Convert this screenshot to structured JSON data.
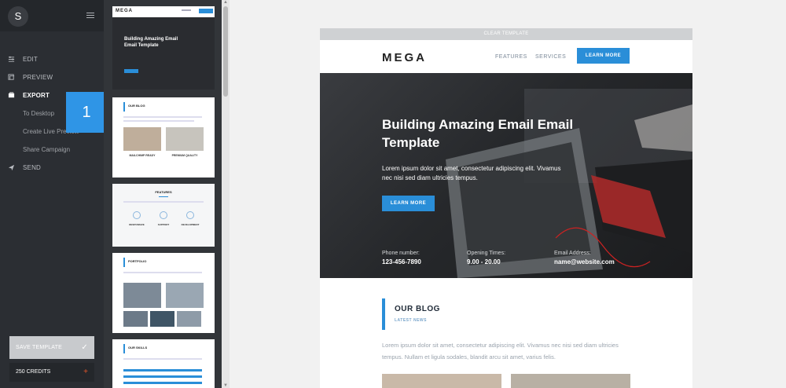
{
  "sidebar": {
    "avatar_letter": "S",
    "menu": [
      {
        "label": "EDIT",
        "icon": "sliders-icon"
      },
      {
        "label": "PREVIEW",
        "icon": "preview-icon"
      },
      {
        "label": "EXPORT",
        "icon": "export-icon"
      }
    ],
    "export_sub": [
      "To Desktop",
      "Create Live Preview",
      "Share Campaign"
    ],
    "send_label": "SEND",
    "badge_number": "1",
    "save_label": "SAVE TEMPLATE",
    "credits_label": "250 CREDITS"
  },
  "preview": {
    "clear_label": "CLEAR TEMPLATE",
    "logo": "MEGA",
    "nav": [
      "FEATURES",
      "SERVICES"
    ],
    "learn_more": "LEARN MORE",
    "hero_title": "Building Amazing Email Email Template",
    "hero_text": "Lorem ipsum dolor sit amet, consectetur adipiscing elit. Vivamus nec nisi sed diam ultricies tempus.",
    "hero_button": "LEARN MORE",
    "info": [
      {
        "label": "Phone number:",
        "value": "123-456-7890"
      },
      {
        "label": "Opening Times:",
        "value": "9.00 - 20.00"
      },
      {
        "label": "Email Address:",
        "value": "name@website.com"
      }
    ],
    "blog_title": "OUR BLOG",
    "blog_sub": "LATEST NEWS",
    "blog_text": "Lorem ipsum dolor sit amet, consectetur adipiscing elit. Vivamus nec nisi sed diam ultricies tempus. Nullam et ligula sodales, blandit arcu sit amet, varius felis."
  },
  "thumbnails": {
    "t1_logo": "MEGA",
    "t1_title": "Building Amazing Email Email Template",
    "t2_title": "OUR BLOG",
    "t2_cap1": "MAILCHIMP READY",
    "t2_cap2": "PREMIUM QUALITY",
    "t3_title": "FEATURES",
    "t3_caps": [
      "RESPONSIVE",
      "SUPPORT",
      "DEVELOPMENT"
    ],
    "t4_title": "PORTFOLIO",
    "t5_title": "OUR SKILLS"
  },
  "colors": {
    "accent": "#2a8ed8",
    "sidebar": "#2b2e33",
    "badge": "#2f95e6"
  }
}
